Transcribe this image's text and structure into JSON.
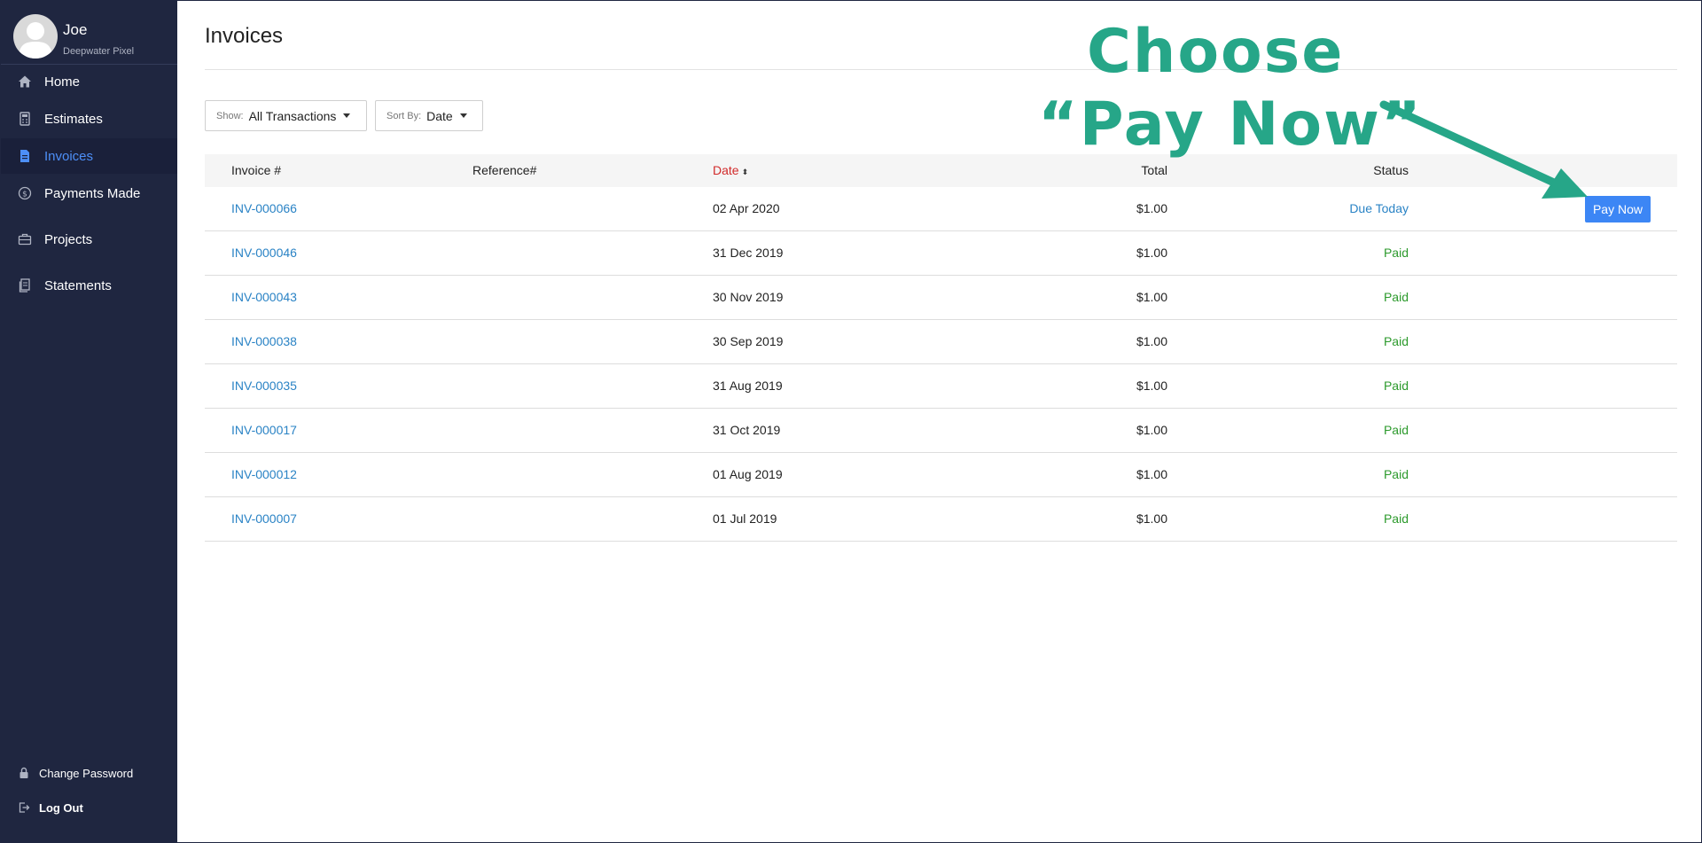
{
  "profile": {
    "name": "Joe",
    "org": "Deepwater Pixel"
  },
  "nav": {
    "items": [
      {
        "label": "Home",
        "icon": "home-icon"
      },
      {
        "label": "Estimates",
        "icon": "calculator-icon"
      },
      {
        "label": "Invoices",
        "icon": "document-icon"
      },
      {
        "label": "Payments Made",
        "icon": "dollar-circle-icon"
      },
      {
        "label": "Projects",
        "icon": "briefcase-icon"
      },
      {
        "label": "Statements",
        "icon": "statement-icon"
      }
    ],
    "active": "Invoices",
    "bottom": [
      {
        "label": "Change Password",
        "icon": "lock-icon"
      },
      {
        "label": "Log Out",
        "icon": "logout-icon"
      }
    ]
  },
  "page": {
    "title": "Invoices"
  },
  "filters": {
    "show_label": "Show:",
    "show_value": "All Transactions",
    "sort_label": "Sort By:",
    "sort_value": "Date"
  },
  "table": {
    "headers": {
      "invoice": "Invoice #",
      "reference": "Reference#",
      "date": "Date",
      "total": "Total",
      "status": "Status"
    },
    "rows": [
      {
        "invoice": "INV-000066",
        "reference": "",
        "date": "02 Apr 2020",
        "total": "$1.00",
        "status": "Due Today",
        "action": "Pay Now"
      },
      {
        "invoice": "INV-000046",
        "reference": "",
        "date": "31 Dec 2019",
        "total": "$1.00",
        "status": "Paid"
      },
      {
        "invoice": "INV-000043",
        "reference": "",
        "date": "30 Nov 2019",
        "total": "$1.00",
        "status": "Paid"
      },
      {
        "invoice": "INV-000038",
        "reference": "",
        "date": "30 Sep 2019",
        "total": "$1.00",
        "status": "Paid"
      },
      {
        "invoice": "INV-000035",
        "reference": "",
        "date": "31 Aug 2019",
        "total": "$1.00",
        "status": "Paid"
      },
      {
        "invoice": "INV-000017",
        "reference": "",
        "date": "31 Oct 2019",
        "total": "$1.00",
        "status": "Paid"
      },
      {
        "invoice": "INV-000012",
        "reference": "",
        "date": "01 Aug 2019",
        "total": "$1.00",
        "status": "Paid"
      },
      {
        "invoice": "INV-000007",
        "reference": "",
        "date": "01 Jul 2019",
        "total": "$1.00",
        "status": "Paid"
      }
    ]
  },
  "annotation": {
    "line1": "Choose",
    "line2": "“Pay Now”",
    "color": "#26a688"
  },
  "colors": {
    "sidebar": "#1f2640",
    "accent": "#3c86f5",
    "link": "#2a83c5",
    "paid": "#2c9a2c",
    "sort_active": "#d12a2a"
  }
}
